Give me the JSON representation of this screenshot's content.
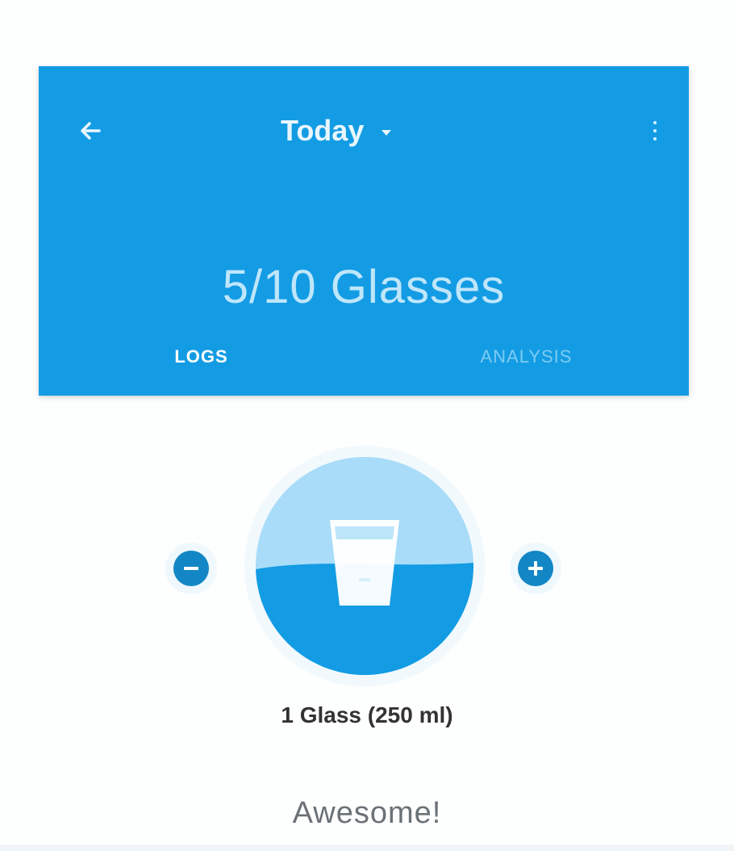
{
  "header": {
    "title": "Today",
    "progress": "5/10 Glasses",
    "glasses_consumed": 5,
    "glasses_goal": 10,
    "icons": {
      "back": "back-arrow-icon",
      "dropdown": "dropdown-icon",
      "menu": "more-vertical-icon"
    },
    "tabs": [
      {
        "label": "LOGS",
        "selected": true
      },
      {
        "label": "ANALYSIS",
        "selected": false
      }
    ]
  },
  "intake": {
    "portion_label": "1 Glass (250 ml)",
    "fill_fraction": 0.5,
    "icons": {
      "decrease": "minus-icon",
      "increase": "plus-icon",
      "glass": "water-glass-icon"
    }
  },
  "status": {
    "message": "Awesome!"
  },
  "colors": {
    "primary": "#139ce4",
    "primary_dark": "#1387c6",
    "water_light": "#a8dcf8",
    "text_dark": "#333333",
    "text_muted": "#6a7277"
  }
}
